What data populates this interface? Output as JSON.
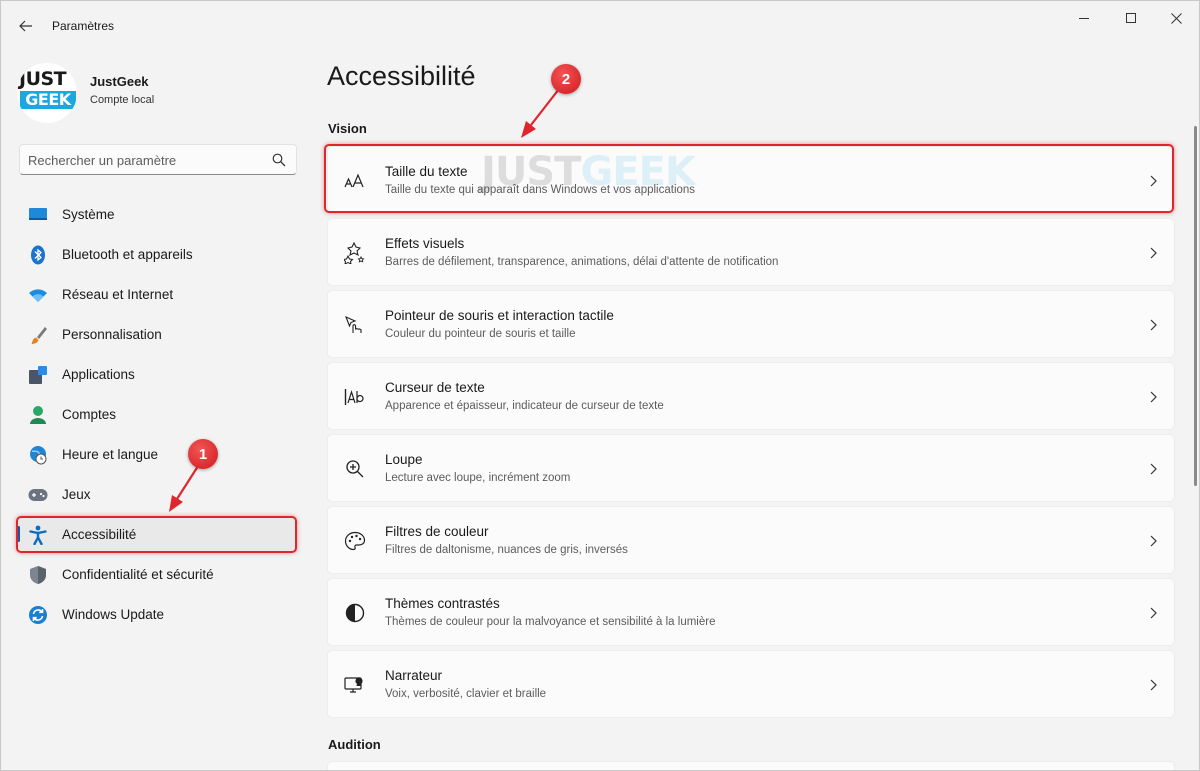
{
  "window": {
    "title": "Paramètres"
  },
  "profile": {
    "name": "JustGeek",
    "account_type": "Compte local",
    "logo_top": "JUST",
    "logo_bottom": "GEEK"
  },
  "search": {
    "placeholder": "Rechercher un paramètre",
    "value": ""
  },
  "sidebar": {
    "items": [
      {
        "label": "Système",
        "icon": "monitor-icon",
        "selected": false
      },
      {
        "label": "Bluetooth et appareils",
        "icon": "bluetooth-icon",
        "selected": false
      },
      {
        "label": "Réseau et Internet",
        "icon": "wifi-icon",
        "selected": false
      },
      {
        "label": "Personnalisation",
        "icon": "brush-icon",
        "selected": false
      },
      {
        "label": "Applications",
        "icon": "apps-icon",
        "selected": false
      },
      {
        "label": "Comptes",
        "icon": "account-icon",
        "selected": false
      },
      {
        "label": "Heure et langue",
        "icon": "globe-clock-icon",
        "selected": false
      },
      {
        "label": "Jeux",
        "icon": "gamepad-icon",
        "selected": false
      },
      {
        "label": "Accessibilité",
        "icon": "accessibility-icon",
        "selected": true
      },
      {
        "label": "Confidentialité et sécurité",
        "icon": "shield-icon",
        "selected": false
      },
      {
        "label": "Windows Update",
        "icon": "update-icon",
        "selected": false
      }
    ]
  },
  "main": {
    "title": "Accessibilité",
    "sections": [
      {
        "title": "Vision",
        "cards": [
          {
            "title": "Taille du texte",
            "description": "Taille du texte qui apparaît dans Windows et vos applications",
            "icon": "text-size-icon"
          },
          {
            "title": "Effets visuels",
            "description": "Barres de défilement, transparence, animations, délai d'attente de notification",
            "icon": "visual-effects-icon"
          },
          {
            "title": "Pointeur de souris et interaction tactile",
            "description": "Couleur du pointeur de souris et taille",
            "icon": "mouse-pointer-icon"
          },
          {
            "title": "Curseur de texte",
            "description": "Apparence et épaisseur, indicateur de curseur de texte",
            "icon": "text-cursor-icon"
          },
          {
            "title": "Loupe",
            "description": "Lecture avec loupe, incrément zoom",
            "icon": "magnifier-icon"
          },
          {
            "title": "Filtres de couleur",
            "description": "Filtres de daltonisme, nuances de gris, inversés",
            "icon": "color-palette-icon"
          },
          {
            "title": "Thèmes contrastés",
            "description": "Thèmes de couleur pour la malvoyance et sensibilité à la lumière",
            "icon": "contrast-icon"
          },
          {
            "title": "Narrateur",
            "description": "Voix, verbosité, clavier et braille",
            "icon": "narrator-icon"
          }
        ]
      },
      {
        "title": "Audition",
        "cards": []
      }
    ]
  },
  "annotations": [
    {
      "number": "1",
      "target": "Accessibilité"
    },
    {
      "number": "2",
      "target": "Taille du texte"
    }
  ],
  "watermark": {
    "part1": "JUST",
    "part2": "GEEK"
  },
  "colors": {
    "accent": "#005fb8",
    "annotation": "#e0262d",
    "brand_blue": "#1ba8e0"
  }
}
